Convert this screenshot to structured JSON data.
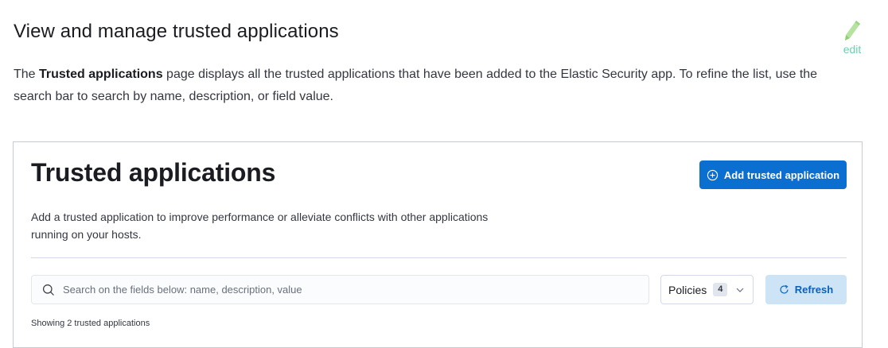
{
  "doc": {
    "title": "View and manage trusted applications",
    "edit_label": "edit",
    "para_prefix": "The ",
    "para_bold": "Trusted applications",
    "para_suffix": " page displays all the trusted applications that have been added to the Elastic Security app. To refine the list, use the search bar to search by name, description, or field value."
  },
  "screenshot": {
    "page_title": "Trusted applications",
    "add_button_label": "Add trusted application",
    "description": "Add a trusted application to improve performance or alleviate conflicts with other applications running on your hosts.",
    "search": {
      "placeholder": "Search on the fields below: name, description, value",
      "value": ""
    },
    "policies": {
      "label": "Policies",
      "count": "4"
    },
    "refresh_label": "Refresh",
    "showing_text": "Showing 2 trusted applications"
  },
  "colors": {
    "primary_button": "#0b6fd1",
    "refresh_button_bg": "#cce4f5",
    "edit_accent": "#6dcfac"
  },
  "icons": [
    "pencil-icon",
    "plus-circle-icon",
    "search-icon",
    "chevron-down-icon",
    "refresh-icon"
  ]
}
